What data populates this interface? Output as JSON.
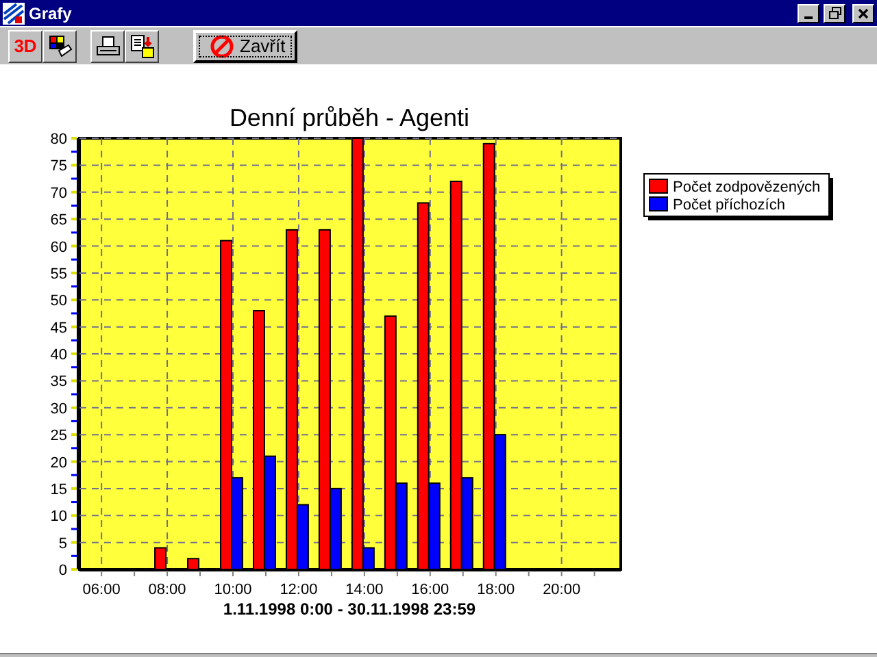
{
  "window": {
    "title": "Grafy"
  },
  "toolbar": {
    "three_d_label": "3D",
    "close_label": "Zavřít"
  },
  "chart": {
    "chart_data": {
      "type": "bar",
      "title": "Denní průběh - Agenti",
      "xlabel": "1.11.1998 0:00 - 30.11.1998 23:59",
      "x": [
        8,
        9,
        10,
        11,
        12,
        13,
        14,
        15,
        16,
        17,
        18
      ],
      "series": [
        {
          "name": "Počet zodpovězených",
          "color": "#ff0000",
          "values": [
            4,
            2,
            61,
            48,
            63,
            63,
            80,
            47,
            68,
            72,
            79
          ]
        },
        {
          "name": "Počet příchozích",
          "color": "#0000ff",
          "values": [
            null,
            null,
            17,
            21,
            12,
            15,
            4,
            16,
            16,
            17,
            25
          ]
        }
      ],
      "xlim": [
        5.33,
        21.8
      ],
      "ylim": [
        0,
        80
      ],
      "yticks": [
        0,
        5,
        10,
        15,
        20,
        25,
        30,
        35,
        40,
        45,
        50,
        55,
        60,
        65,
        70,
        75,
        80
      ],
      "xticks": [
        {
          "value": 6,
          "label": "06:00"
        },
        {
          "value": 8,
          "label": "08:00"
        },
        {
          "value": 10,
          "label": "10:00"
        },
        {
          "value": 12,
          "label": "12:00"
        },
        {
          "value": 14,
          "label": "14:00"
        },
        {
          "value": 16,
          "label": "16:00"
        },
        {
          "value": 18,
          "label": "18:00"
        },
        {
          "value": 20,
          "label": "20:00"
        }
      ],
      "grid": true,
      "legend": true
    }
  }
}
